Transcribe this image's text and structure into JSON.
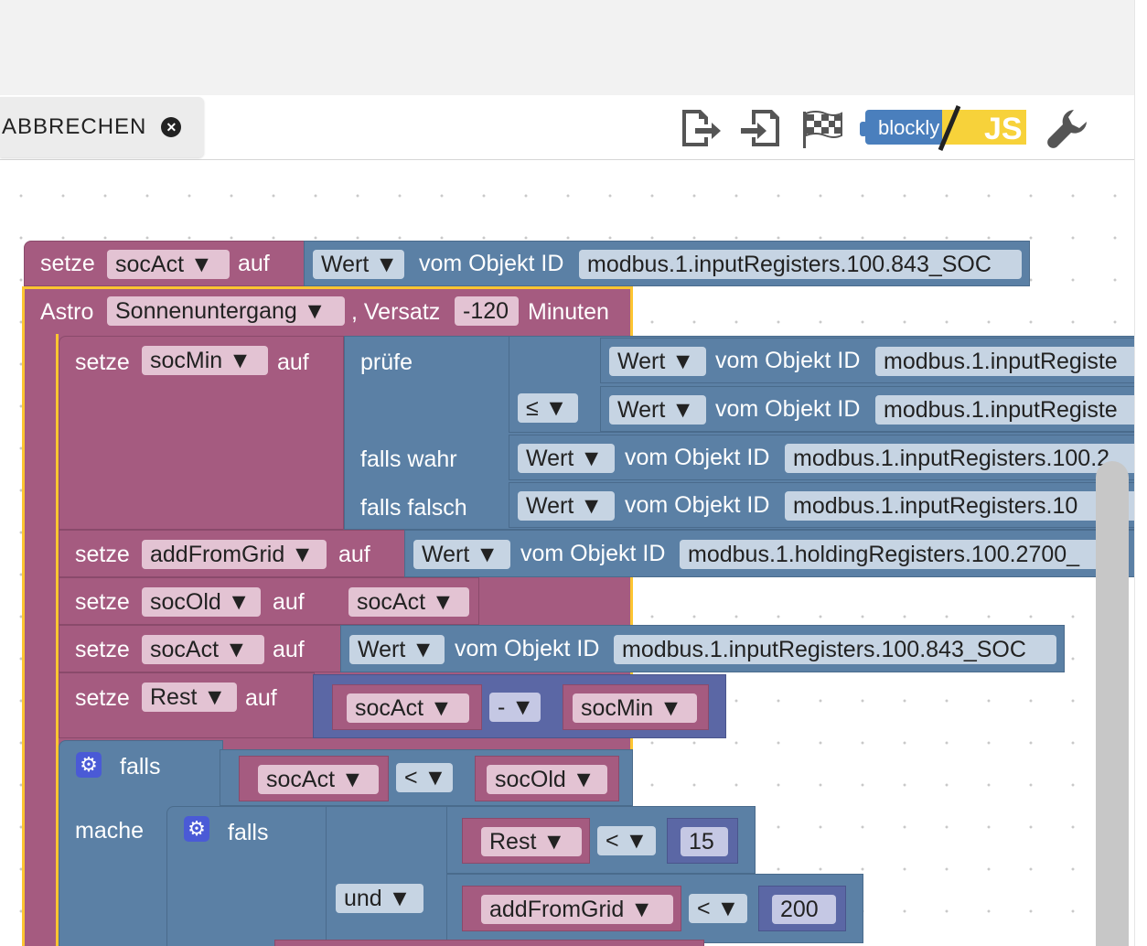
{
  "toolbar": {
    "cancel_label": "ABBRECHEN",
    "logo_left": "blockly",
    "logo_right": "JS"
  },
  "icons": [
    "close-icon",
    "export-icon",
    "import-icon",
    "checkered-flag-icon",
    "wrench-icon"
  ],
  "colors": {
    "variable_block": "#a55b80",
    "logic_block": "#5b80a5",
    "math_block": "#5b67a5",
    "selection": "#fcc531"
  },
  "blocks": {
    "b1": {
      "kw1": "setze",
      "var": "socAct",
      "kw2": "auf",
      "val": "Wert",
      "of": "vom Objekt ID",
      "id": "modbus.1.inputRegisters.100.843_SOC"
    },
    "astro": {
      "kw": "Astro",
      "event": "Sonnenuntergang",
      "offset_kw": ", Versatz",
      "offset": "-120",
      "unit": "Minuten"
    },
    "b2": {
      "kw1": "setze",
      "var": "socMin",
      "kw2": "auf",
      "check": "prüfe",
      "if_true": "falls wahr",
      "if_false": "falls falsch",
      "op": "≤",
      "r1": {
        "val": "Wert",
        "of": "vom Objekt ID",
        "id": "modbus.1.inputRegiste"
      },
      "r2": {
        "val": "Wert",
        "of": "vom Objekt ID",
        "id": "modbus.1.inputRegiste"
      },
      "r3": {
        "val": "Wert",
        "of": "vom Objekt ID",
        "id": "modbus.1.inputRegisters.100.2"
      },
      "r4": {
        "val": "Wert",
        "of": "vom Objekt ID",
        "id": "modbus.1.inputRegisters.10"
      }
    },
    "b3": {
      "kw1": "setze",
      "var": "addFromGrid",
      "kw2": "auf",
      "val": "Wert",
      "of": "vom Objekt ID",
      "id": "modbus.1.holdingRegisters.100.2700_"
    },
    "b4": {
      "kw1": "setze",
      "var": "socOld",
      "kw2": "auf",
      "src": "socAct"
    },
    "b5": {
      "kw1": "setze",
      "var": "socAct",
      "kw2": "auf",
      "val": "Wert",
      "of": "vom Objekt ID",
      "id": "modbus.1.inputRegisters.100.843_SOC"
    },
    "b6": {
      "kw1": "setze",
      "var": "Rest",
      "kw2": "auf",
      "a": "socAct",
      "op": "-",
      "b": "socMin"
    },
    "if1": {
      "kw": "falls",
      "do": "mache",
      "a": "socAct",
      "op": "<",
      "b": "socOld"
    },
    "if2": {
      "kw": "falls",
      "and": "und",
      "a": "Rest",
      "op1": "<",
      "n1": "15",
      "c": "addFromGrid",
      "op2": "<",
      "n2": "200"
    }
  }
}
